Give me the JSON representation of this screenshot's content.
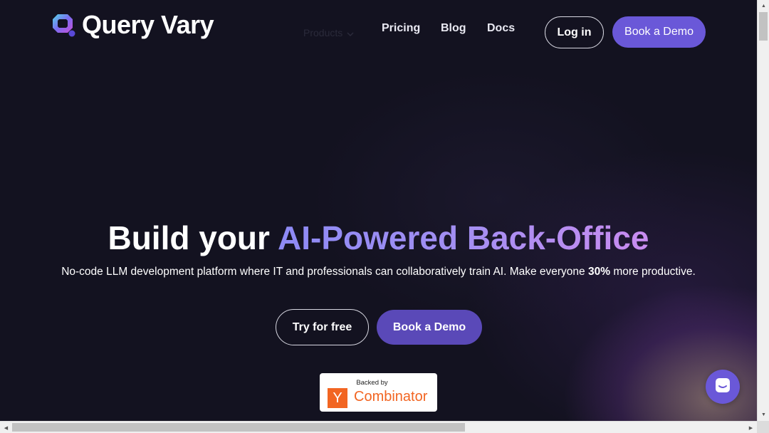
{
  "header": {
    "brand": "Query Vary",
    "nav": {
      "products": "Products",
      "pricing": "Pricing",
      "blog": "Blog",
      "docs": "Docs"
    },
    "login": "Log in",
    "book_demo": "Book a Demo"
  },
  "hero": {
    "title_plain": "Build your",
    "title_highlight": "AI-Powered Back-Office",
    "subtitle_pre": "No-code LLM development platform where IT and professionals can collaboratively train AI. Make everyone",
    "subtitle_bold": "30%",
    "subtitle_post": "more productive.",
    "try_free": "Try for free",
    "book_demo": "Book a Demo"
  },
  "badge": {
    "backed_by": "Backed by",
    "logo_letter": "Y",
    "name": "Combinator"
  },
  "colors": {
    "accent": "#6a58d8",
    "background": "#131220",
    "yc_orange": "#f26522"
  },
  "icons": {
    "logo": "query-vary-logo-icon",
    "chevron": "chevron-down-icon",
    "chat": "chat-icon"
  }
}
